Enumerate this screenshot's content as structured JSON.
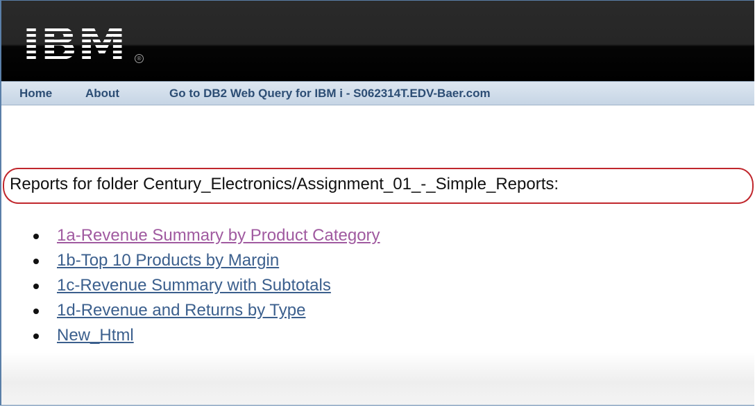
{
  "header": {
    "logo_text": "IBM",
    "registered_mark": "®"
  },
  "nav": {
    "items": [
      {
        "label": "Home"
      },
      {
        "label": "About"
      },
      {
        "label": "Go to DB2 Web Query for IBM i - S062314T.EDV-Baer.com"
      }
    ]
  },
  "main": {
    "heading": "Reports for folder Century_Electronics/Assignment_01_-_Simple_Reports:",
    "reports": [
      {
        "label": "1a-Revenue Summary by Product Category",
        "visited": true
      },
      {
        "label": "1b-Top 10 Products by Margin",
        "visited": false
      },
      {
        "label": "1c-Revenue Summary with Subtotals",
        "visited": false
      },
      {
        "label": "1d-Revenue and Returns by Type",
        "visited": false
      },
      {
        "label": "New_Html",
        "visited": false
      }
    ]
  },
  "colors": {
    "header_bg": "#000000",
    "nav_text": "#2c4d74",
    "link": "#3b5f8d",
    "visited_link": "#a05aa0",
    "highlight": "#c0262c"
  }
}
